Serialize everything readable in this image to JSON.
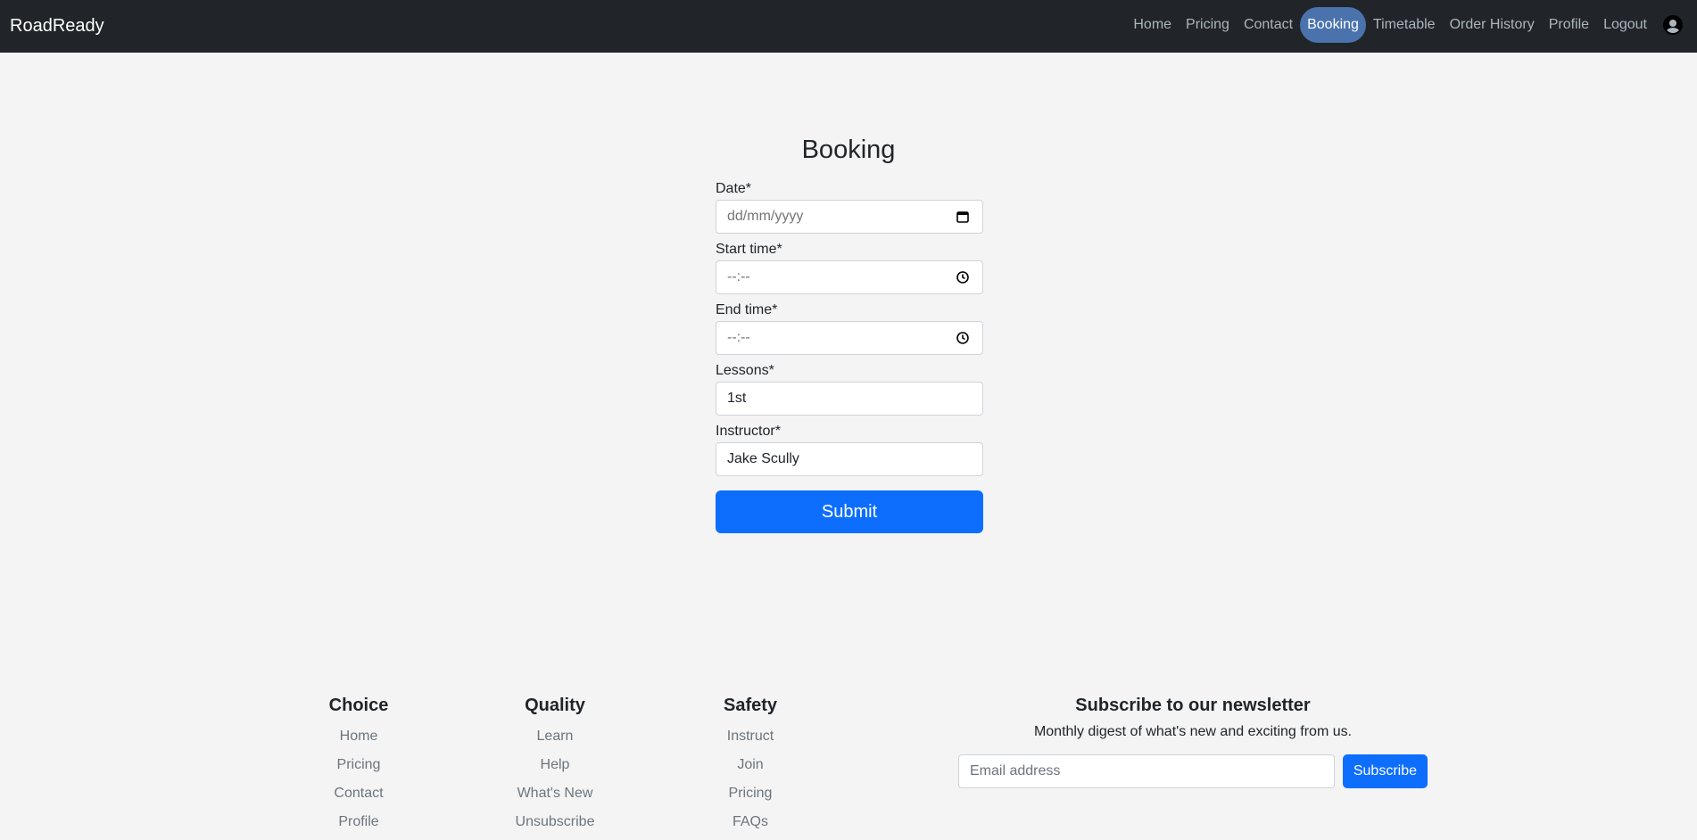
{
  "nav": {
    "brand": "RoadReady",
    "links": [
      "Home",
      "Pricing",
      "Contact",
      "Booking",
      "Timetable",
      "Order History",
      "Profile",
      "Logout"
    ],
    "active": "Booking",
    "avatar_icon": "user-circle-icon"
  },
  "booking": {
    "title": "Booking",
    "date_label": "Date*",
    "date_placeholder": "dd/mm/yyyy",
    "start_label": "Start time*",
    "start_placeholder": "--:--",
    "end_label": "End time*",
    "end_placeholder": "--:--",
    "lessons_label": "Lessons*",
    "lessons_value": "1st",
    "instructor_label": "Instructor*",
    "instructor_value": "Jake Scully",
    "submit_label": "Submit"
  },
  "footer": {
    "columns": [
      {
        "title": "Choice",
        "links": [
          "Home",
          "Pricing",
          "Contact",
          "Profile"
        ]
      },
      {
        "title": "Quality",
        "links": [
          "Learn",
          "Help",
          "What's New",
          "Unsubscribe"
        ]
      },
      {
        "title": "Safety",
        "links": [
          "Instruct",
          "Join",
          "Pricing",
          "FAQs"
        ]
      }
    ],
    "newsletter": {
      "title": "Subscribe to our newsletter",
      "text": "Monthly digest of what's new and exciting from us.",
      "email_placeholder": "Email address",
      "button_label": "Subscribe"
    }
  },
  "colors": {
    "navbar_bg": "#212529",
    "active_pill": "#4a73ad",
    "primary": "#0d6efd",
    "page_bg": "#f4f4f4"
  }
}
